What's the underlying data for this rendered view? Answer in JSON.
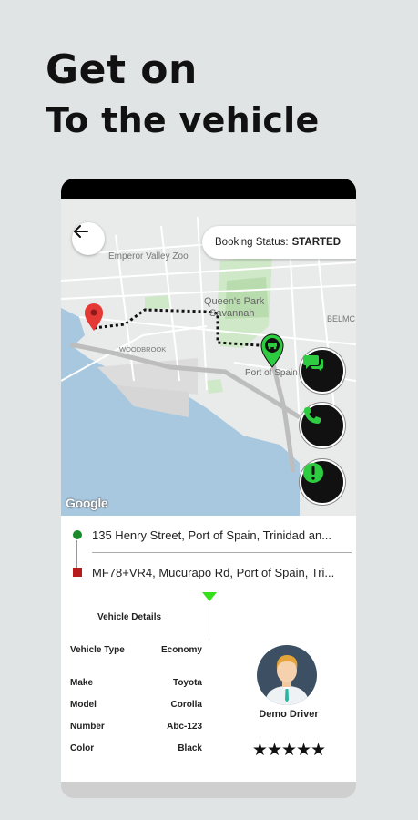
{
  "headline": {
    "line1": "Get on",
    "line2": "To the vehicle"
  },
  "map": {
    "booking_status_label": "Booking Status:",
    "booking_status_value": "STARTED",
    "labels": {
      "zoo": "Emperor Valley Zoo",
      "park1": "Queen's Park",
      "park2": "Savannah",
      "port": "Port of Spain",
      "woodbrook": "WOODBROOK",
      "belmont": "BELMC"
    },
    "google_logo": "Google",
    "icons": {
      "back": "back-arrow-icon",
      "chat": "chat-icon",
      "phone": "phone-icon",
      "alert": "alert-icon",
      "pickup": "pickup-pin-icon",
      "car": "car-pin-icon"
    },
    "colors": {
      "route_pin": "#e53935",
      "car_pin": "#2ecc40",
      "fab": "#111111",
      "fab_icon": "#2ecc40"
    }
  },
  "addresses": {
    "pickup": "135 Henry Street, Port of Spain, Trinidad an...",
    "dropoff": "MF78+VR4, Mucurapo Rd, Port of Spain, Tri..."
  },
  "vehicle": {
    "title": "Vehicle Details",
    "rows": [
      {
        "key": "Vehicle Type",
        "value": "Economy"
      },
      {
        "key": "Make",
        "value": "Toyota"
      },
      {
        "key": "Model",
        "value": "Corolla"
      },
      {
        "key": "Number",
        "value": "Abc-123"
      },
      {
        "key": "Color",
        "value": "Black"
      }
    ]
  },
  "driver": {
    "name": "Demo Driver",
    "rating": "★★★★★",
    "rating_value": 5
  }
}
